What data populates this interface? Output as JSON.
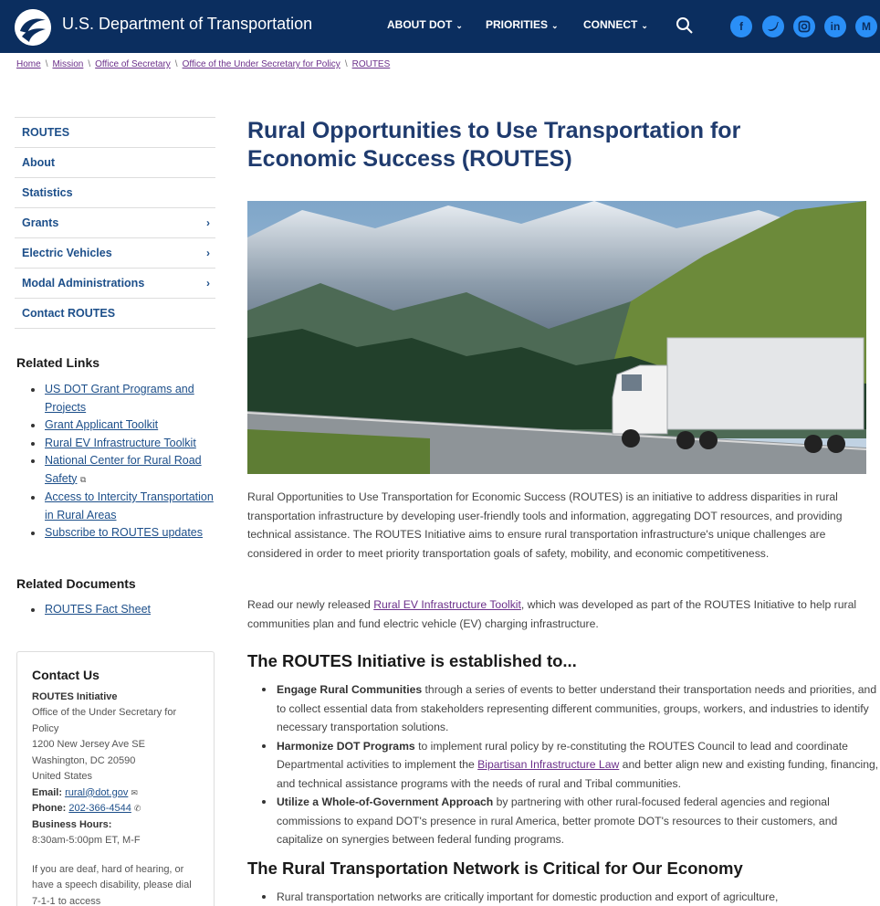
{
  "header": {
    "title": "U.S. Department of Transportation",
    "nav": [
      "ABOUT DOT",
      "PRIORITIES",
      "CONNECT"
    ],
    "social": [
      "f",
      "t",
      "ig",
      "in",
      "M"
    ],
    "colors": {
      "bar": "#0b2e5f",
      "social": "#2a8ff7"
    }
  },
  "breadcrumb": [
    "Home",
    "Mission",
    "Office of Secretary",
    "Office of the Under Secretary for Policy",
    "ROUTES"
  ],
  "sidebar": {
    "nav": [
      {
        "label": "ROUTES",
        "arrow": ""
      },
      {
        "label": "About",
        "arrow": ""
      },
      {
        "label": "Statistics",
        "arrow": ""
      },
      {
        "label": "Grants",
        "arrow": "›"
      },
      {
        "label": "Electric Vehicles",
        "arrow": "›"
      },
      {
        "label": "Modal Administrations",
        "arrow": "›"
      },
      {
        "label": "Contact ROUTES",
        "arrow": ""
      }
    ],
    "related_links_heading": "Related Links",
    "related_links": [
      "US DOT Grant Programs and Projects",
      "Grant Applicant Toolkit",
      "Rural EV Infrastructure Toolkit",
      "National Center for Rural Road Safety",
      "Access to Intercity Transportation in Rural Areas",
      "Subscribe to ROUTES updates"
    ],
    "related_docs_heading": "Related Documents",
    "related_docs": [
      "ROUTES Fact Sheet"
    ]
  },
  "contact": {
    "heading": "Contact Us",
    "org": "ROUTES Initiative",
    "address": [
      "Office of the Under Secretary for Policy",
      "1200 New Jersey Ave SE",
      "Washington, DC 20590",
      "United States"
    ],
    "email_label": "Email:",
    "email": "rural@dot.gov",
    "phone_label": "Phone:",
    "phone": "202-366-4544",
    "hours_label": "Business Hours:",
    "hours": "8:30am-5:00pm ET, M-F",
    "deaf_note": "If you are deaf, hard of hearing, or have a speech disability, please dial 7-1-1 to access"
  },
  "main": {
    "title": "Rural Opportunities to Use Transportation for Economic Success (ROUTES)",
    "intro": "Rural Opportunities to Use Transportation for Economic Success (ROUTES) is an initiative to address disparities in rural transportation infrastructure by developing user-friendly tools and information, aggregating DOT resources, and providing technical assistance. The ROUTES Initiative aims to ensure rural transportation infrastructure's unique challenges are considered in order to meet priority transportation goals of safety, mobility, and economic competitiveness.",
    "read_pre": "Read our newly released ",
    "read_link": "Rural EV Infrastructure Toolkit",
    "read_post": ", which was developed as part of the ROUTES Initiative to help rural communities plan and fund electric vehicle (EV) charging infrastructure.",
    "h2_initiative": "The ROUTES Initiative is established to...",
    "b1_bold": "Engage Rural Communities",
    "b1_text": " through a series of events to better understand their transportation needs and priorities, and to collect essential data from stakeholders representing different communities, groups, workers, and industries to identify necessary transportation solutions.",
    "b2_bold": "Harmonize DOT Programs",
    "b2_text_a": " to implement rural policy by re-constituting the ROUTES Council to lead and coordinate Departmental activities to implement the ",
    "b2_link": "Bipartisan Infrastructure Law",
    "b2_text_b": " and better align new and existing funding, financing, and technical assistance programs with the needs of rural and Tribal communities.",
    "b3_bold": "Utilize a Whole-of-Government Approach",
    "b3_text": " by partnering with other rural-focused federal agencies and regional commissions to expand DOT's presence in rural America, better promote DOT's resources to their customers, and capitalize on synergies between federal funding programs.",
    "h2_network": "The Rural Transportation Network is Critical for Our Economy",
    "n1_text": "Rural transportation networks are critically important for domestic production and export of agriculture,"
  }
}
